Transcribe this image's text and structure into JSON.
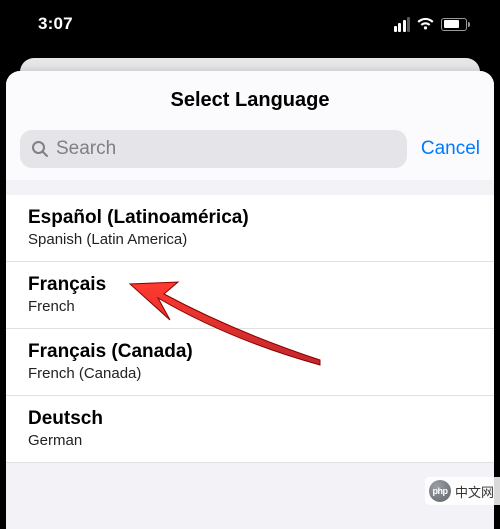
{
  "status": {
    "time": "3:07"
  },
  "sheet": {
    "title": "Select Language",
    "search_placeholder": "Search",
    "cancel_label": "Cancel"
  },
  "languages": [
    {
      "native": "Español (Latinoamérica)",
      "english": "Spanish (Latin America)"
    },
    {
      "native": "Français",
      "english": "French"
    },
    {
      "native": "Français (Canada)",
      "english": "French (Canada)"
    },
    {
      "native": "Deutsch",
      "english": "German"
    }
  ],
  "watermark": {
    "logo": "php",
    "text": "中文网"
  }
}
